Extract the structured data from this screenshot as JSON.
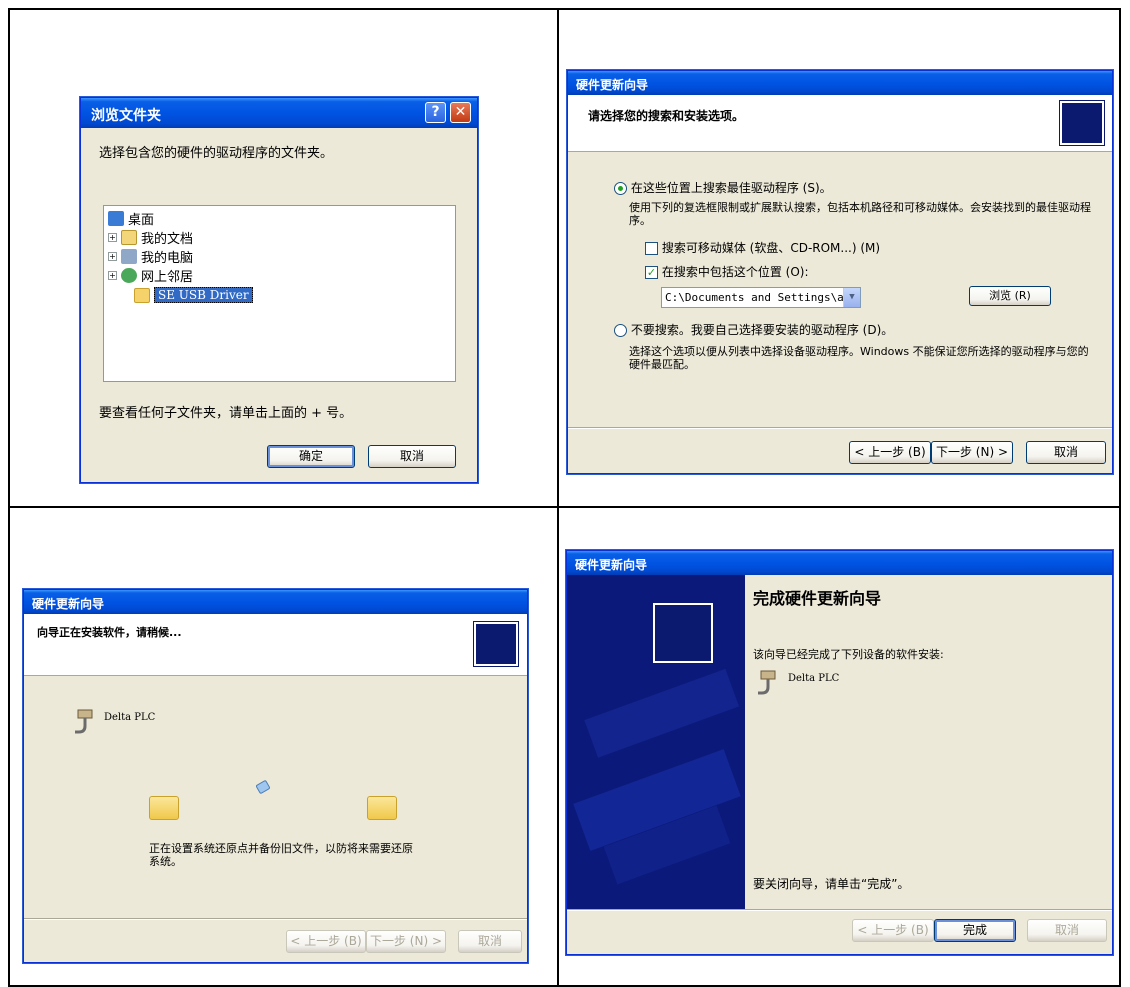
{
  "browse": {
    "title": "浏览文件夹",
    "prompt": "选择包含您的硬件的驱动程序的文件夹。",
    "tree": [
      {
        "label": "桌面",
        "icon": "desktop-icon"
      },
      {
        "label": "我的文档",
        "icon": "my-documents-icon"
      },
      {
        "label": "我的电脑",
        "icon": "my-computer-icon"
      },
      {
        "label": "网上邻居",
        "icon": "network-icon"
      },
      {
        "label": "SE USB Driver",
        "icon": "folder-open-icon"
      }
    ],
    "hint": "要查看任何子文件夹，请单击上面的 + 号。",
    "ok": "确定",
    "cancel": "取消",
    "help_glyph": "?",
    "close_glyph": "✕",
    "expand_glyph": "+"
  },
  "wizard1": {
    "title": "硬件更新向导",
    "header": "请选择您的搜索和安装选项。",
    "opt1": "在这些位置上搜索最佳驱动程序 (S)。",
    "opt1_desc": "使用下列的复选框限制或扩展默认搜索，包括本机路径和可移动媒体。会安装找到的最佳驱动程序。",
    "chk1": "搜索可移动媒体 (软盘、CD-ROM...) (M)",
    "chk2": "在搜索中包括这个位置 (O):",
    "path": "C:\\Documents and Settings\\admin\\桌面\\SE US",
    "browse": "浏览 (R)",
    "opt2": "不要搜索。我要自己选择要安装的驱动程序 (D)。",
    "opt2_desc": "选择这个选项以便从列表中选择设备驱动程序。Windows 不能保证您所选择的驱动程序与您的硬件最匹配。",
    "back": "< 上一步 (B)",
    "next": "下一步 (N) >",
    "cancel": "取消",
    "check_glyph": "✓",
    "combo_arrow_glyph": "▼"
  },
  "wizard2": {
    "title": "硬件更新向导",
    "header": "向导正在安装软件，请稍候...",
    "device": "Delta PLC",
    "status": "正在设置系统还原点并备份旧文件，以防将来需要还原系统。",
    "back": "< 上一步 (B)",
    "next": "下一步 (N) >",
    "cancel": "取消"
  },
  "wizard3": {
    "title": "硬件更新向导",
    "heading": "完成硬件更新向导",
    "desc": "该向导已经完成了下列设备的软件安装:",
    "device": "Delta PLC",
    "close_hint": "要关闭向导，请单击“完成”。",
    "back": "< 上一步 (B)",
    "finish": "完成",
    "cancel": "取消"
  },
  "colors": {
    "titlebar": "#0054e3",
    "dialog_bg": "#ece9d8",
    "selection": "#316ac5",
    "side_panel": "#0b1a7a"
  }
}
